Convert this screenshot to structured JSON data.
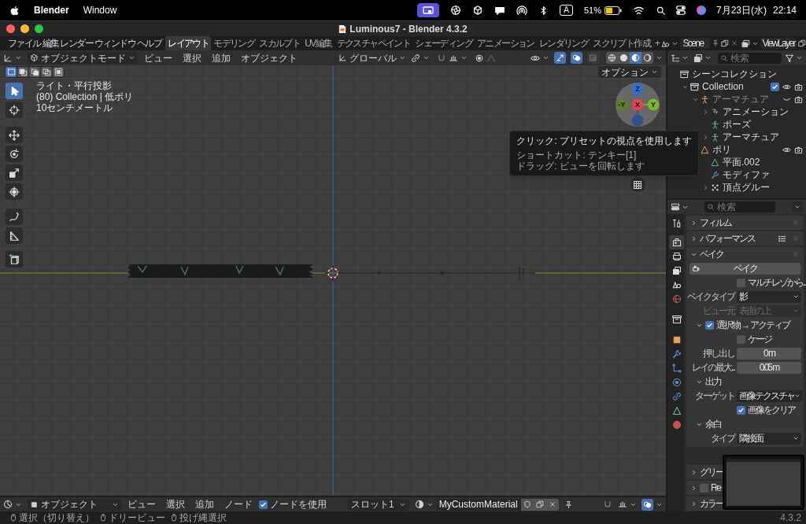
{
  "menubar": {
    "app_name": "Blender",
    "menus": [
      "Window"
    ],
    "input_source": "A",
    "battery": "51%",
    "date": "7月23日(水)",
    "time": "22:14"
  },
  "window": {
    "title": "Luminous7 - Blender 4.3.2"
  },
  "topbar": {
    "menus": [
      "ファイル",
      "編集",
      "レンダー",
      "ウィンドウ",
      "ヘルプ"
    ],
    "workspaces": [
      {
        "label": "レイアウト",
        "selected": true
      },
      {
        "label": "モデリング",
        "selected": false
      },
      {
        "label": "スカルプト",
        "selected": false
      },
      {
        "label": "UV編集",
        "selected": false
      },
      {
        "label": "テクスチャペイント",
        "selected": false
      },
      {
        "label": "シェーディング",
        "selected": false
      },
      {
        "label": "アニメーション",
        "selected": false
      },
      {
        "label": "レンダリング",
        "selected": false
      },
      {
        "label": "スクリプト作成",
        "selected": false
      }
    ],
    "add_tab": "+",
    "scene": "Scene",
    "view_layer": "ViewLayer"
  },
  "viewport": {
    "mode": "オブジェクトモード",
    "menus": [
      "ビュー",
      "選択",
      "追加",
      "オブジェクト"
    ],
    "orientation": "グローバル",
    "toggles": [
      {
        "kind": "gizmo",
        "on": true
      },
      {
        "kind": "overlay",
        "on": true
      },
      {
        "kind": "xray",
        "on": false
      }
    ],
    "shading": [
      {
        "kind": "wireframe",
        "selected": false
      },
      {
        "kind": "solid",
        "selected": false
      },
      {
        "kind": "material",
        "selected": true
      },
      {
        "kind": "rendered",
        "selected": false
      }
    ],
    "select_modes": [
      {
        "kind": "set",
        "selected": true
      },
      {
        "kind": "extend",
        "selected": false
      },
      {
        "kind": "subtract",
        "selected": false
      },
      {
        "kind": "invert",
        "selected": false
      },
      {
        "kind": "intersect",
        "selected": false
      }
    ],
    "options": "オプション",
    "info": [
      "ライト・平行投影",
      "(80) Collection | 低ポリ",
      "10センチメートル"
    ],
    "tools": [
      {
        "kind": "select",
        "selected": true
      },
      {
        "kind": "cursor",
        "selected": false
      },
      {
        "kind": "move",
        "selected": false
      },
      {
        "kind": "rotate",
        "selected": false
      },
      {
        "kind": "scale",
        "selected": false
      },
      {
        "kind": "transform",
        "selected": false
      },
      {
        "kind": "annotate",
        "selected": false
      },
      {
        "kind": "measure",
        "selected": false
      },
      {
        "kind": "add-cube",
        "selected": false
      }
    ],
    "gizmo": [
      {
        "label": "Z",
        "color": "#2f6fd6"
      },
      {
        "label": "-Y",
        "color": "#5d7d2a"
      },
      {
        "label": "X",
        "color": "#e2434d"
      },
      {
        "label": "Y",
        "color": "#7bb335"
      },
      {
        "color": "#34528a"
      }
    ]
  },
  "tooltip": {
    "lines": [
      "クリック: プリセットの視点を使用します",
      "ショートカット: テンキー[1]",
      "ドラッグ: ビューを回転します"
    ]
  },
  "outliner": {
    "search_placeholder": "検索",
    "tree": [
      {
        "label": "シーンコレクション",
        "kind": "scene-collection",
        "children": [
          {
            "label": "Collection",
            "kind": "collection",
            "expanded": true,
            "checked": true,
            "visible": true,
            "renderable": true,
            "children": [
              {
                "label": "アーマチュア",
                "kind": "armature",
                "expanded": true,
                "visible": false,
                "renderable": true,
                "children": [
                  {
                    "label": "アニメーション",
                    "kind": "animation",
                    "expanded": false
                  },
                  {
                    "label": "ポーズ",
                    "kind": "pose"
                  },
                  {
                    "label": "アーマチュア",
                    "kind": "armature-data",
                    "expanded": false
                  }
                ]
              },
              {
                "label": "ポリ",
                "kind": "mesh",
                "visible": true,
                "renderable": true,
                "children": [
                  {
                    "label": "平面.002",
                    "kind": "mesh-data"
                  },
                  {
                    "label": "モディファ",
                    "kind": "modifier"
                  },
                  {
                    "label": "頂点グルー",
                    "kind": "vertex-groups",
                    "expanded": false
                  }
                ]
              }
            ]
          }
        ]
      }
    ]
  },
  "properties": {
    "search_placeholder": "検索",
    "tabs": [
      {
        "kind": "tool",
        "selected": false
      },
      {
        "kind": "render",
        "selected": true
      },
      {
        "kind": "output",
        "selected": false
      },
      {
        "kind": "view-layer",
        "selected": false
      },
      {
        "kind": "scene",
        "selected": false
      },
      {
        "kind": "world",
        "selected": false
      },
      {
        "kind": "collection",
        "selected": false
      },
      {
        "kind": "object",
        "selected": false
      },
      {
        "kind": "modifier",
        "selected": false
      },
      {
        "kind": "particles",
        "selected": false
      },
      {
        "kind": "physics",
        "selected": false
      },
      {
        "kind": "constraints",
        "selected": false
      },
      {
        "kind": "data",
        "selected": false
      },
      {
        "kind": "material",
        "selected": false
      }
    ],
    "panels": [
      {
        "kind": "plain",
        "label": "フィルム",
        "expanded": false
      },
      {
        "kind": "presets",
        "label": "パフォーマンス",
        "expanded": false
      },
      {
        "kind": "plain",
        "label": "ベイク",
        "expanded": true,
        "rows": [
          {
            "kind": "button",
            "label": "ベイク"
          },
          {
            "kind": "checkbox",
            "label": "マルチレゾから...",
            "checked": false
          },
          {
            "kind": "dropdown",
            "label": "ベイクタイプ",
            "value": "影",
            "disabled": false
          },
          {
            "kind": "dropdown",
            "label": "ビュー元",
            "value": "表面の上",
            "disabled": true
          },
          {
            "kind": "subpanel-check",
            "label": "選択物 → アクティブ",
            "checked": true,
            "expanded": true
          },
          {
            "kind": "checkbox",
            "label": "ケージ",
            "checked": false
          },
          {
            "kind": "field",
            "label": "押し出し",
            "value": "0 m"
          },
          {
            "kind": "field",
            "label": "レイの最大...",
            "value": "0.05 m"
          },
          {
            "kind": "subpanel",
            "label": "出力",
            "expanded": true
          },
          {
            "kind": "dropdown",
            "label": "ターゲット",
            "value": "画像テクスチャ",
            "disabled": false
          },
          {
            "kind": "checkbox",
            "label": "画像をクリア",
            "checked": true
          },
          {
            "kind": "subpanel",
            "label": "余白",
            "expanded": true
          },
          {
            "kind": "dropdown",
            "label": "タイプ",
            "value": "隣接面",
            "disabled": false
          }
        ]
      },
      {
        "kind": "plain",
        "label": "グリー",
        "expanded": false
      },
      {
        "kind": "check",
        "label": "Fre",
        "expanded": false,
        "checked": false
      },
      {
        "kind": "plain",
        "label": "カラー",
        "expanded": false
      }
    ]
  },
  "node_header": {
    "object_type": "オブジェクト",
    "menus": [
      "ビュー",
      "選択",
      "追加",
      "ノード"
    ],
    "use_nodes": {
      "label": "ノードを使用",
      "checked": true
    },
    "slot": "スロット1",
    "material": "MyCustomMaterial"
  },
  "status_bar": {
    "hints": [
      "選択（切り替え）",
      "ドリービュー",
      "投げ縄選択"
    ],
    "version": "4.3.2"
  }
}
